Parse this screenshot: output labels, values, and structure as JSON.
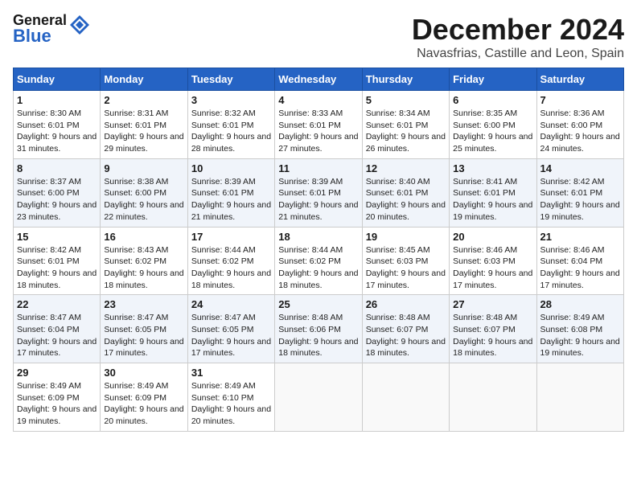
{
  "header": {
    "logo": {
      "general": "General",
      "blue": "Blue"
    },
    "title": "December 2024",
    "subtitle": "Navasfrias, Castille and Leon, Spain"
  },
  "calendar": {
    "days_of_week": [
      "Sunday",
      "Monday",
      "Tuesday",
      "Wednesday",
      "Thursday",
      "Friday",
      "Saturday"
    ],
    "weeks": [
      [
        {
          "day": "1",
          "sunrise": "Sunrise: 8:30 AM",
          "sunset": "Sunset: 6:01 PM",
          "daylight": "Daylight: 9 hours and 31 minutes."
        },
        {
          "day": "2",
          "sunrise": "Sunrise: 8:31 AM",
          "sunset": "Sunset: 6:01 PM",
          "daylight": "Daylight: 9 hours and 29 minutes."
        },
        {
          "day": "3",
          "sunrise": "Sunrise: 8:32 AM",
          "sunset": "Sunset: 6:01 PM",
          "daylight": "Daylight: 9 hours and 28 minutes."
        },
        {
          "day": "4",
          "sunrise": "Sunrise: 8:33 AM",
          "sunset": "Sunset: 6:01 PM",
          "daylight": "Daylight: 9 hours and 27 minutes."
        },
        {
          "day": "5",
          "sunrise": "Sunrise: 8:34 AM",
          "sunset": "Sunset: 6:01 PM",
          "daylight": "Daylight: 9 hours and 26 minutes."
        },
        {
          "day": "6",
          "sunrise": "Sunrise: 8:35 AM",
          "sunset": "Sunset: 6:00 PM",
          "daylight": "Daylight: 9 hours and 25 minutes."
        },
        {
          "day": "7",
          "sunrise": "Sunrise: 8:36 AM",
          "sunset": "Sunset: 6:00 PM",
          "daylight": "Daylight: 9 hours and 24 minutes."
        }
      ],
      [
        {
          "day": "8",
          "sunrise": "Sunrise: 8:37 AM",
          "sunset": "Sunset: 6:00 PM",
          "daylight": "Daylight: 9 hours and 23 minutes."
        },
        {
          "day": "9",
          "sunrise": "Sunrise: 8:38 AM",
          "sunset": "Sunset: 6:00 PM",
          "daylight": "Daylight: 9 hours and 22 minutes."
        },
        {
          "day": "10",
          "sunrise": "Sunrise: 8:39 AM",
          "sunset": "Sunset: 6:01 PM",
          "daylight": "Daylight: 9 hours and 21 minutes."
        },
        {
          "day": "11",
          "sunrise": "Sunrise: 8:39 AM",
          "sunset": "Sunset: 6:01 PM",
          "daylight": "Daylight: 9 hours and 21 minutes."
        },
        {
          "day": "12",
          "sunrise": "Sunrise: 8:40 AM",
          "sunset": "Sunset: 6:01 PM",
          "daylight": "Daylight: 9 hours and 20 minutes."
        },
        {
          "day": "13",
          "sunrise": "Sunrise: 8:41 AM",
          "sunset": "Sunset: 6:01 PM",
          "daylight": "Daylight: 9 hours and 19 minutes."
        },
        {
          "day": "14",
          "sunrise": "Sunrise: 8:42 AM",
          "sunset": "Sunset: 6:01 PM",
          "daylight": "Daylight: 9 hours and 19 minutes."
        }
      ],
      [
        {
          "day": "15",
          "sunrise": "Sunrise: 8:42 AM",
          "sunset": "Sunset: 6:01 PM",
          "daylight": "Daylight: 9 hours and 18 minutes."
        },
        {
          "day": "16",
          "sunrise": "Sunrise: 8:43 AM",
          "sunset": "Sunset: 6:02 PM",
          "daylight": "Daylight: 9 hours and 18 minutes."
        },
        {
          "day": "17",
          "sunrise": "Sunrise: 8:44 AM",
          "sunset": "Sunset: 6:02 PM",
          "daylight": "Daylight: 9 hours and 18 minutes."
        },
        {
          "day": "18",
          "sunrise": "Sunrise: 8:44 AM",
          "sunset": "Sunset: 6:02 PM",
          "daylight": "Daylight: 9 hours and 18 minutes."
        },
        {
          "day": "19",
          "sunrise": "Sunrise: 8:45 AM",
          "sunset": "Sunset: 6:03 PM",
          "daylight": "Daylight: 9 hours and 17 minutes."
        },
        {
          "day": "20",
          "sunrise": "Sunrise: 8:46 AM",
          "sunset": "Sunset: 6:03 PM",
          "daylight": "Daylight: 9 hours and 17 minutes."
        },
        {
          "day": "21",
          "sunrise": "Sunrise: 8:46 AM",
          "sunset": "Sunset: 6:04 PM",
          "daylight": "Daylight: 9 hours and 17 minutes."
        }
      ],
      [
        {
          "day": "22",
          "sunrise": "Sunrise: 8:47 AM",
          "sunset": "Sunset: 6:04 PM",
          "daylight": "Daylight: 9 hours and 17 minutes."
        },
        {
          "day": "23",
          "sunrise": "Sunrise: 8:47 AM",
          "sunset": "Sunset: 6:05 PM",
          "daylight": "Daylight: 9 hours and 17 minutes."
        },
        {
          "day": "24",
          "sunrise": "Sunrise: 8:47 AM",
          "sunset": "Sunset: 6:05 PM",
          "daylight": "Daylight: 9 hours and 17 minutes."
        },
        {
          "day": "25",
          "sunrise": "Sunrise: 8:48 AM",
          "sunset": "Sunset: 6:06 PM",
          "daylight": "Daylight: 9 hours and 18 minutes."
        },
        {
          "day": "26",
          "sunrise": "Sunrise: 8:48 AM",
          "sunset": "Sunset: 6:07 PM",
          "daylight": "Daylight: 9 hours and 18 minutes."
        },
        {
          "day": "27",
          "sunrise": "Sunrise: 8:48 AM",
          "sunset": "Sunset: 6:07 PM",
          "daylight": "Daylight: 9 hours and 18 minutes."
        },
        {
          "day": "28",
          "sunrise": "Sunrise: 8:49 AM",
          "sunset": "Sunset: 6:08 PM",
          "daylight": "Daylight: 9 hours and 19 minutes."
        }
      ],
      [
        {
          "day": "29",
          "sunrise": "Sunrise: 8:49 AM",
          "sunset": "Sunset: 6:09 PM",
          "daylight": "Daylight: 9 hours and 19 minutes."
        },
        {
          "day": "30",
          "sunrise": "Sunrise: 8:49 AM",
          "sunset": "Sunset: 6:09 PM",
          "daylight": "Daylight: 9 hours and 20 minutes."
        },
        {
          "day": "31",
          "sunrise": "Sunrise: 8:49 AM",
          "sunset": "Sunset: 6:10 PM",
          "daylight": "Daylight: 9 hours and 20 minutes."
        },
        null,
        null,
        null,
        null
      ]
    ]
  }
}
